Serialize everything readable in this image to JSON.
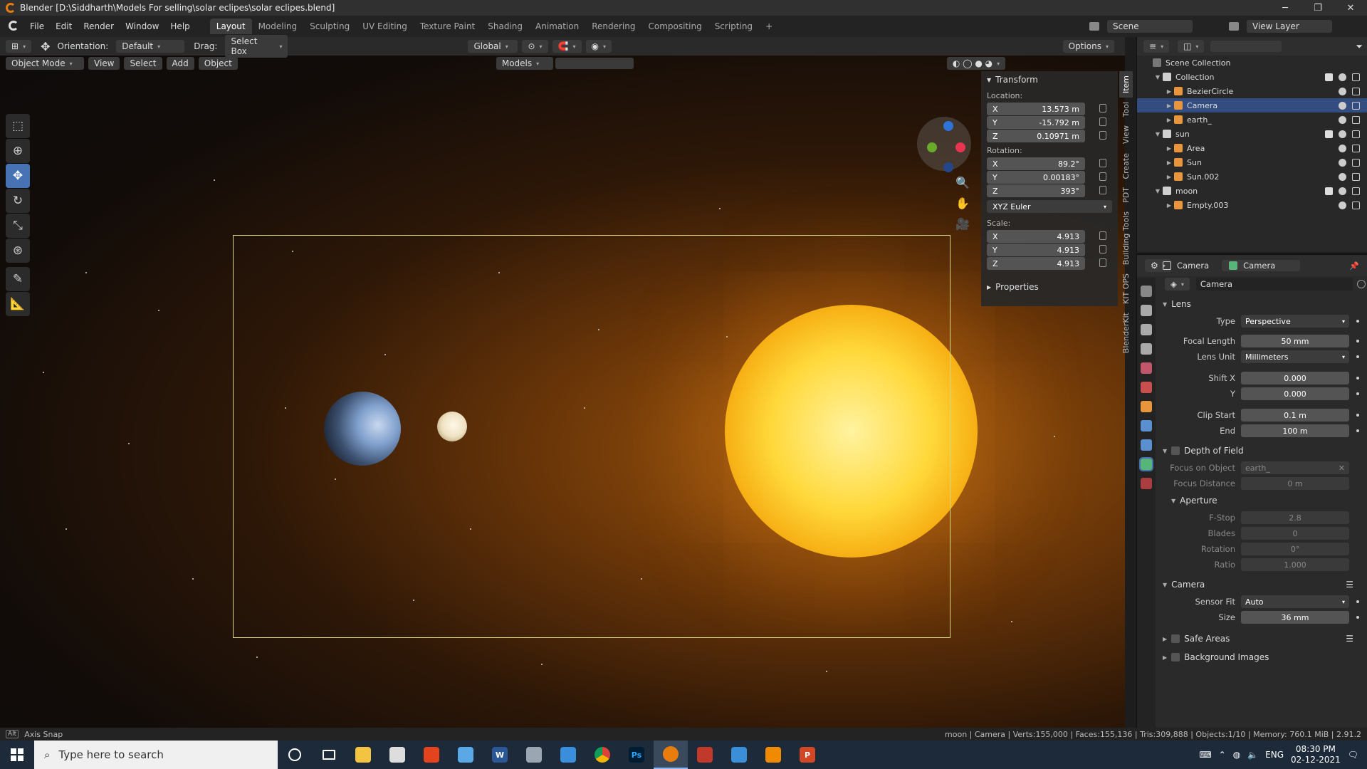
{
  "window": {
    "title": "Blender [D:\\Siddharth\\Models For selling\\solar eclipes\\solar eclipes.blend]"
  },
  "menu": {
    "items": [
      "File",
      "Edit",
      "Render",
      "Window",
      "Help"
    ]
  },
  "workspaces": [
    "Layout",
    "Modeling",
    "Sculpting",
    "UV Editing",
    "Texture Paint",
    "Shading",
    "Animation",
    "Rendering",
    "Compositing",
    "Scripting",
    "+"
  ],
  "top_right": {
    "scene_label": "Scene",
    "view_layer_label": "View Layer"
  },
  "header1": {
    "orientation_label": "Orientation:",
    "orientation_value": "Default",
    "drag_label": "Drag:",
    "drag_value": "Select Box",
    "transform_space": "Global",
    "options": "Options"
  },
  "header2": {
    "mode": "Object Mode",
    "view": "View",
    "select": "Select",
    "add": "Add",
    "object": "Object",
    "collection_filter": "Models"
  },
  "npanel": {
    "transform_title": "Transform",
    "location_label": "Location:",
    "location": [
      {
        "axis": "X",
        "value": "13.573 m"
      },
      {
        "axis": "Y",
        "value": "-15.792 m"
      },
      {
        "axis": "Z",
        "value": "0.10971 m"
      }
    ],
    "rotation_label": "Rotation:",
    "rotation": [
      {
        "axis": "X",
        "value": "89.2°"
      },
      {
        "axis": "Y",
        "value": "0.00183°"
      },
      {
        "axis": "Z",
        "value": "393°"
      }
    ],
    "rotation_mode": "XYZ Euler",
    "scale_label": "Scale:",
    "scale": [
      {
        "axis": "X",
        "value": "4.913"
      },
      {
        "axis": "Y",
        "value": "4.913"
      },
      {
        "axis": "Z",
        "value": "4.913"
      }
    ],
    "properties_title": "Properties"
  },
  "vtabs": [
    "Item",
    "Tool",
    "View",
    "Create",
    "PDT",
    "Building Tools",
    "KIT OPS",
    "BlenderKit"
  ],
  "outliner": {
    "root": "Scene Collection",
    "rows": [
      {
        "label": "Collection",
        "indent": 1,
        "icon": "collection",
        "selected": false
      },
      {
        "label": "BezierCircle",
        "indent": 2,
        "icon": "curve",
        "selected": false
      },
      {
        "label": "Camera",
        "indent": 2,
        "icon": "camera",
        "selected": true
      },
      {
        "label": "earth_",
        "indent": 2,
        "icon": "mesh",
        "selected": false
      },
      {
        "label": "sun",
        "indent": 1,
        "icon": "collection",
        "selected": false
      },
      {
        "label": "Area",
        "indent": 2,
        "icon": "light",
        "selected": false
      },
      {
        "label": "Sun",
        "indent": 2,
        "icon": "light",
        "selected": false
      },
      {
        "label": "Sun.002",
        "indent": 2,
        "icon": "mesh",
        "selected": false
      },
      {
        "label": "moon",
        "indent": 1,
        "icon": "collection",
        "selected": false
      },
      {
        "label": "Empty.003",
        "indent": 2,
        "icon": "empty",
        "selected": false
      }
    ]
  },
  "props": {
    "breadcrumb_object": "Camera",
    "breadcrumb_data": "Camera",
    "data_name": "Camera",
    "lens": {
      "title": "Lens",
      "type_label": "Type",
      "type": "Perspective",
      "focal_label": "Focal Length",
      "focal": "50 mm",
      "unit_label": "Lens Unit",
      "unit": "Millimeters",
      "shiftx_label": "Shift X",
      "shiftx": "0.000",
      "shifty_label": "Y",
      "shifty": "0.000",
      "clipstart_label": "Clip Start",
      "clipstart": "0.1 m",
      "clipend_label": "End",
      "clipend": "100 m"
    },
    "dof": {
      "title": "Depth of Field",
      "focus_obj_label": "Focus on Object",
      "focus_obj": "earth_",
      "focus_dist_label": "Focus Distance",
      "focus_dist": "0 m"
    },
    "aperture": {
      "title": "Aperture",
      "fstop_label": "F-Stop",
      "fstop": "2.8",
      "blades_label": "Blades",
      "blades": "0",
      "rotation_label": "Rotation",
      "rotation": "0°",
      "ratio_label": "Ratio",
      "ratio": "1.000"
    },
    "camera": {
      "title": "Camera",
      "sensor_fit_label": "Sensor Fit",
      "sensor_fit": "Auto",
      "size_label": "Size",
      "size": "36 mm"
    },
    "safe_areas": "Safe Areas",
    "bg_images": "Background Images"
  },
  "statusbar": {
    "left": "Axis Snap",
    "right": "moon | Camera | Verts:155,000 | Faces:155,136 | Tris:309,888 | Objects:1/10 | Memory: 760.1 MiB | 2.91.2"
  },
  "taskbar": {
    "search": "Type here to search",
    "lang": "ENG",
    "time": "08:30 PM",
    "date": "02-12-2021"
  },
  "colors": {
    "accent": "#4772b3",
    "selected_row": "#334d80",
    "blender_orange": "#e87d0d",
    "camera_frame": "#d6d67a"
  }
}
